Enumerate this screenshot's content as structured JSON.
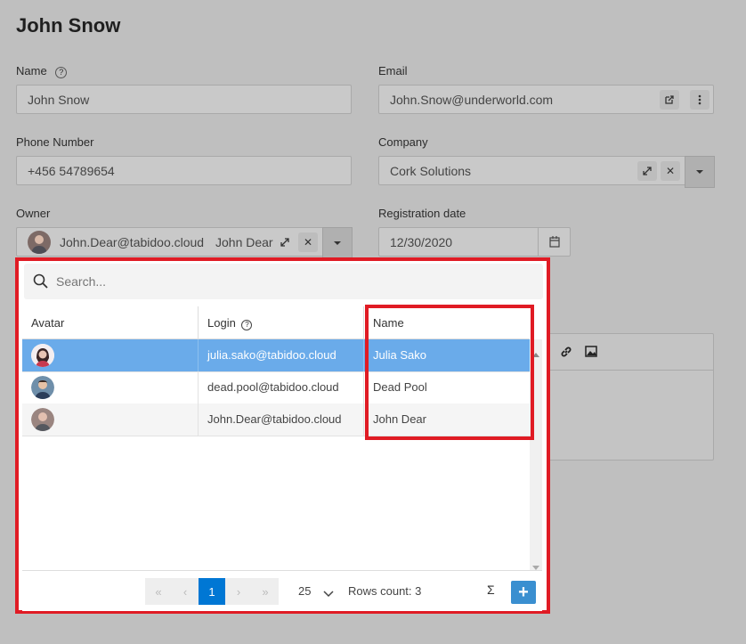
{
  "page": {
    "title": "John Snow"
  },
  "form": {
    "name": {
      "label": "Name",
      "value": "John Snow"
    },
    "email": {
      "label": "Email",
      "value": "John.Snow@underworld.com"
    },
    "phone": {
      "label": "Phone Number",
      "value": "+456 54789654"
    },
    "company": {
      "label": "Company",
      "value": "Cork Solutions"
    },
    "owner": {
      "label": "Owner",
      "login": "John.Dear@tabidoo.cloud",
      "name": "John Dear"
    },
    "registration": {
      "label": "Registration date",
      "value": "12/30/2020"
    }
  },
  "dropdown": {
    "search_placeholder": "Search...",
    "columns": {
      "avatar": "Avatar",
      "login": "Login",
      "name": "Name"
    },
    "rows": [
      {
        "login": "julia.sako@tabidoo.cloud",
        "name": "Julia Sako",
        "selected": true
      },
      {
        "login": "dead.pool@tabidoo.cloud",
        "name": "Dead Pool",
        "selected": false
      },
      {
        "login": "John.Dear@tabidoo.cloud",
        "name": "John Dear",
        "selected": false
      }
    ],
    "pager": {
      "first": "«",
      "prev": "‹",
      "page": "1",
      "next": "›",
      "last": "»",
      "page_size": "25",
      "rows_count": "Rows count: 3",
      "sum": "Σ",
      "add": "+"
    }
  },
  "colors": {
    "highlight": "#e01b24",
    "selected_row": "#6aabea",
    "primary": "#0077d4",
    "add": "#3a8fd0"
  }
}
